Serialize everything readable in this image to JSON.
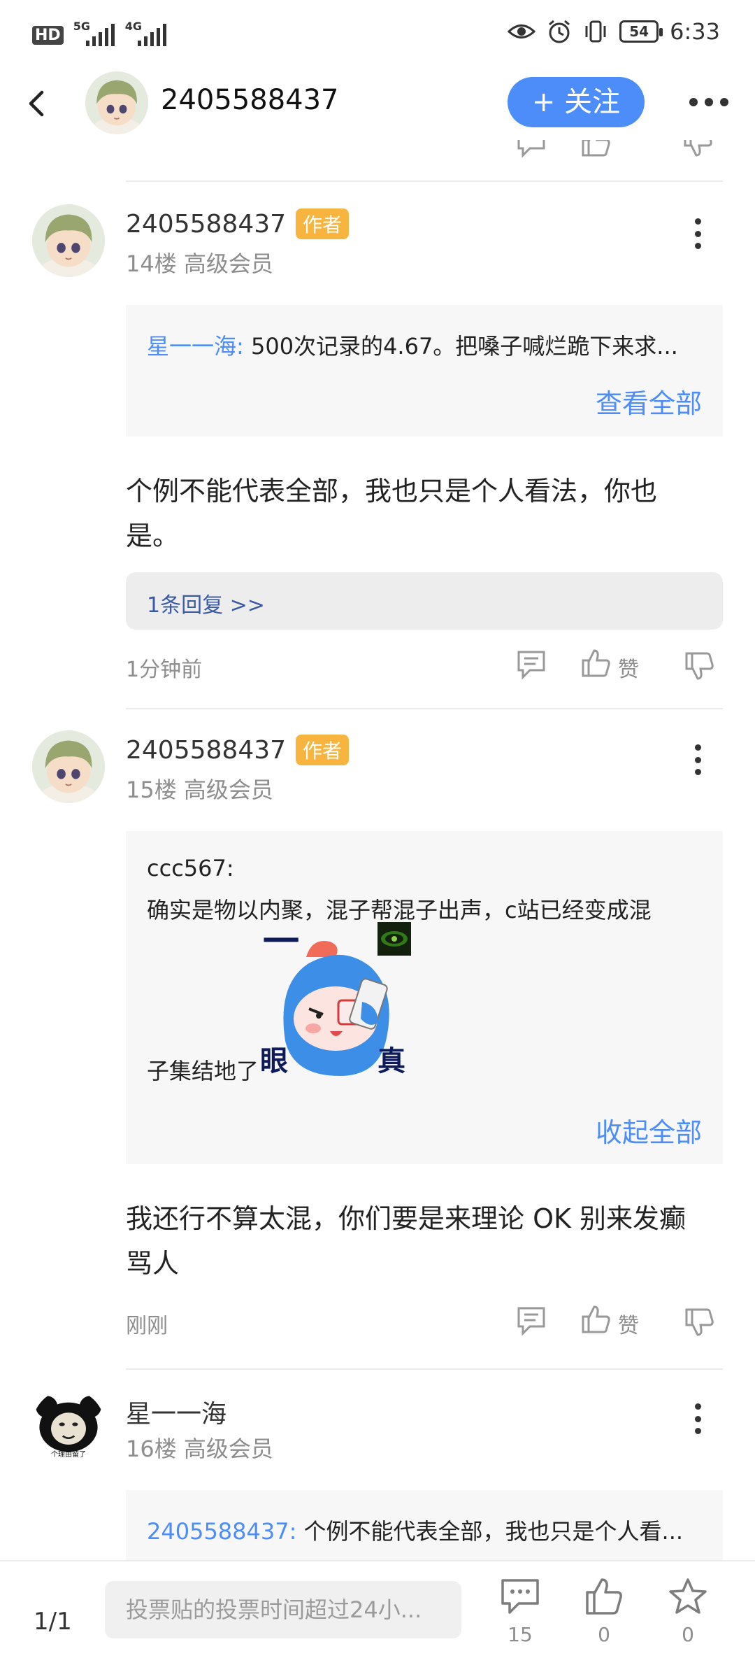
{
  "status_bar": {
    "hd": "HD",
    "sim1_network": "5G",
    "sim2_network": "4G",
    "battery": "54",
    "time": "6:33"
  },
  "header": {
    "title": "2405588437",
    "follow_label": "+ 关注"
  },
  "posts": [
    {
      "author": "2405588437",
      "badge": "作者",
      "meta": "14楼 高级会员",
      "quote_user": "星一一海:",
      "quote_text": "500次记录的4.67。把嗓子喊烂跪下来求...",
      "quote_action": "查看全部",
      "body_line1": "个例不能代表全部，我也只是个人看法，你也",
      "body_line2": "是。",
      "replies": "1条回复 >>",
      "time": "1分钟前",
      "like_label": "赞"
    },
    {
      "author": "2405588437",
      "badge": "作者",
      "meta": "15楼 高级会员",
      "quote_user": "ccc567:",
      "quote_text_line1": "确实是物以内聚，混子帮混子出声，c站已经变成混",
      "quote_text_line2": "子集结地了",
      "sticker_top": "一",
      "sticker_left": "眼",
      "sticker_right": "真",
      "quote_action": "收起全部",
      "body_line1": "我还行不算太混，你们要是来理论 OK 别来发癫",
      "body_line2": "骂人",
      "time": "刚刚",
      "like_label": "赞"
    },
    {
      "author": "星一一海",
      "meta": "16楼 高级会员",
      "avatar_caption": "个理由留了",
      "quote_user": "2405588437:",
      "quote_text": "个例不能代表全部，我也只是个人看..."
    }
  ],
  "bottom_bar": {
    "page": "1/1",
    "input_placeholder": "投票贴的投票时间超过24小...",
    "comment_count": "15",
    "like_count": "0",
    "star_count": "0"
  },
  "colors": {
    "accent": "#4c8dfa",
    "badge": "#f7b53f",
    "reply_link": "#3b5aa3"
  }
}
